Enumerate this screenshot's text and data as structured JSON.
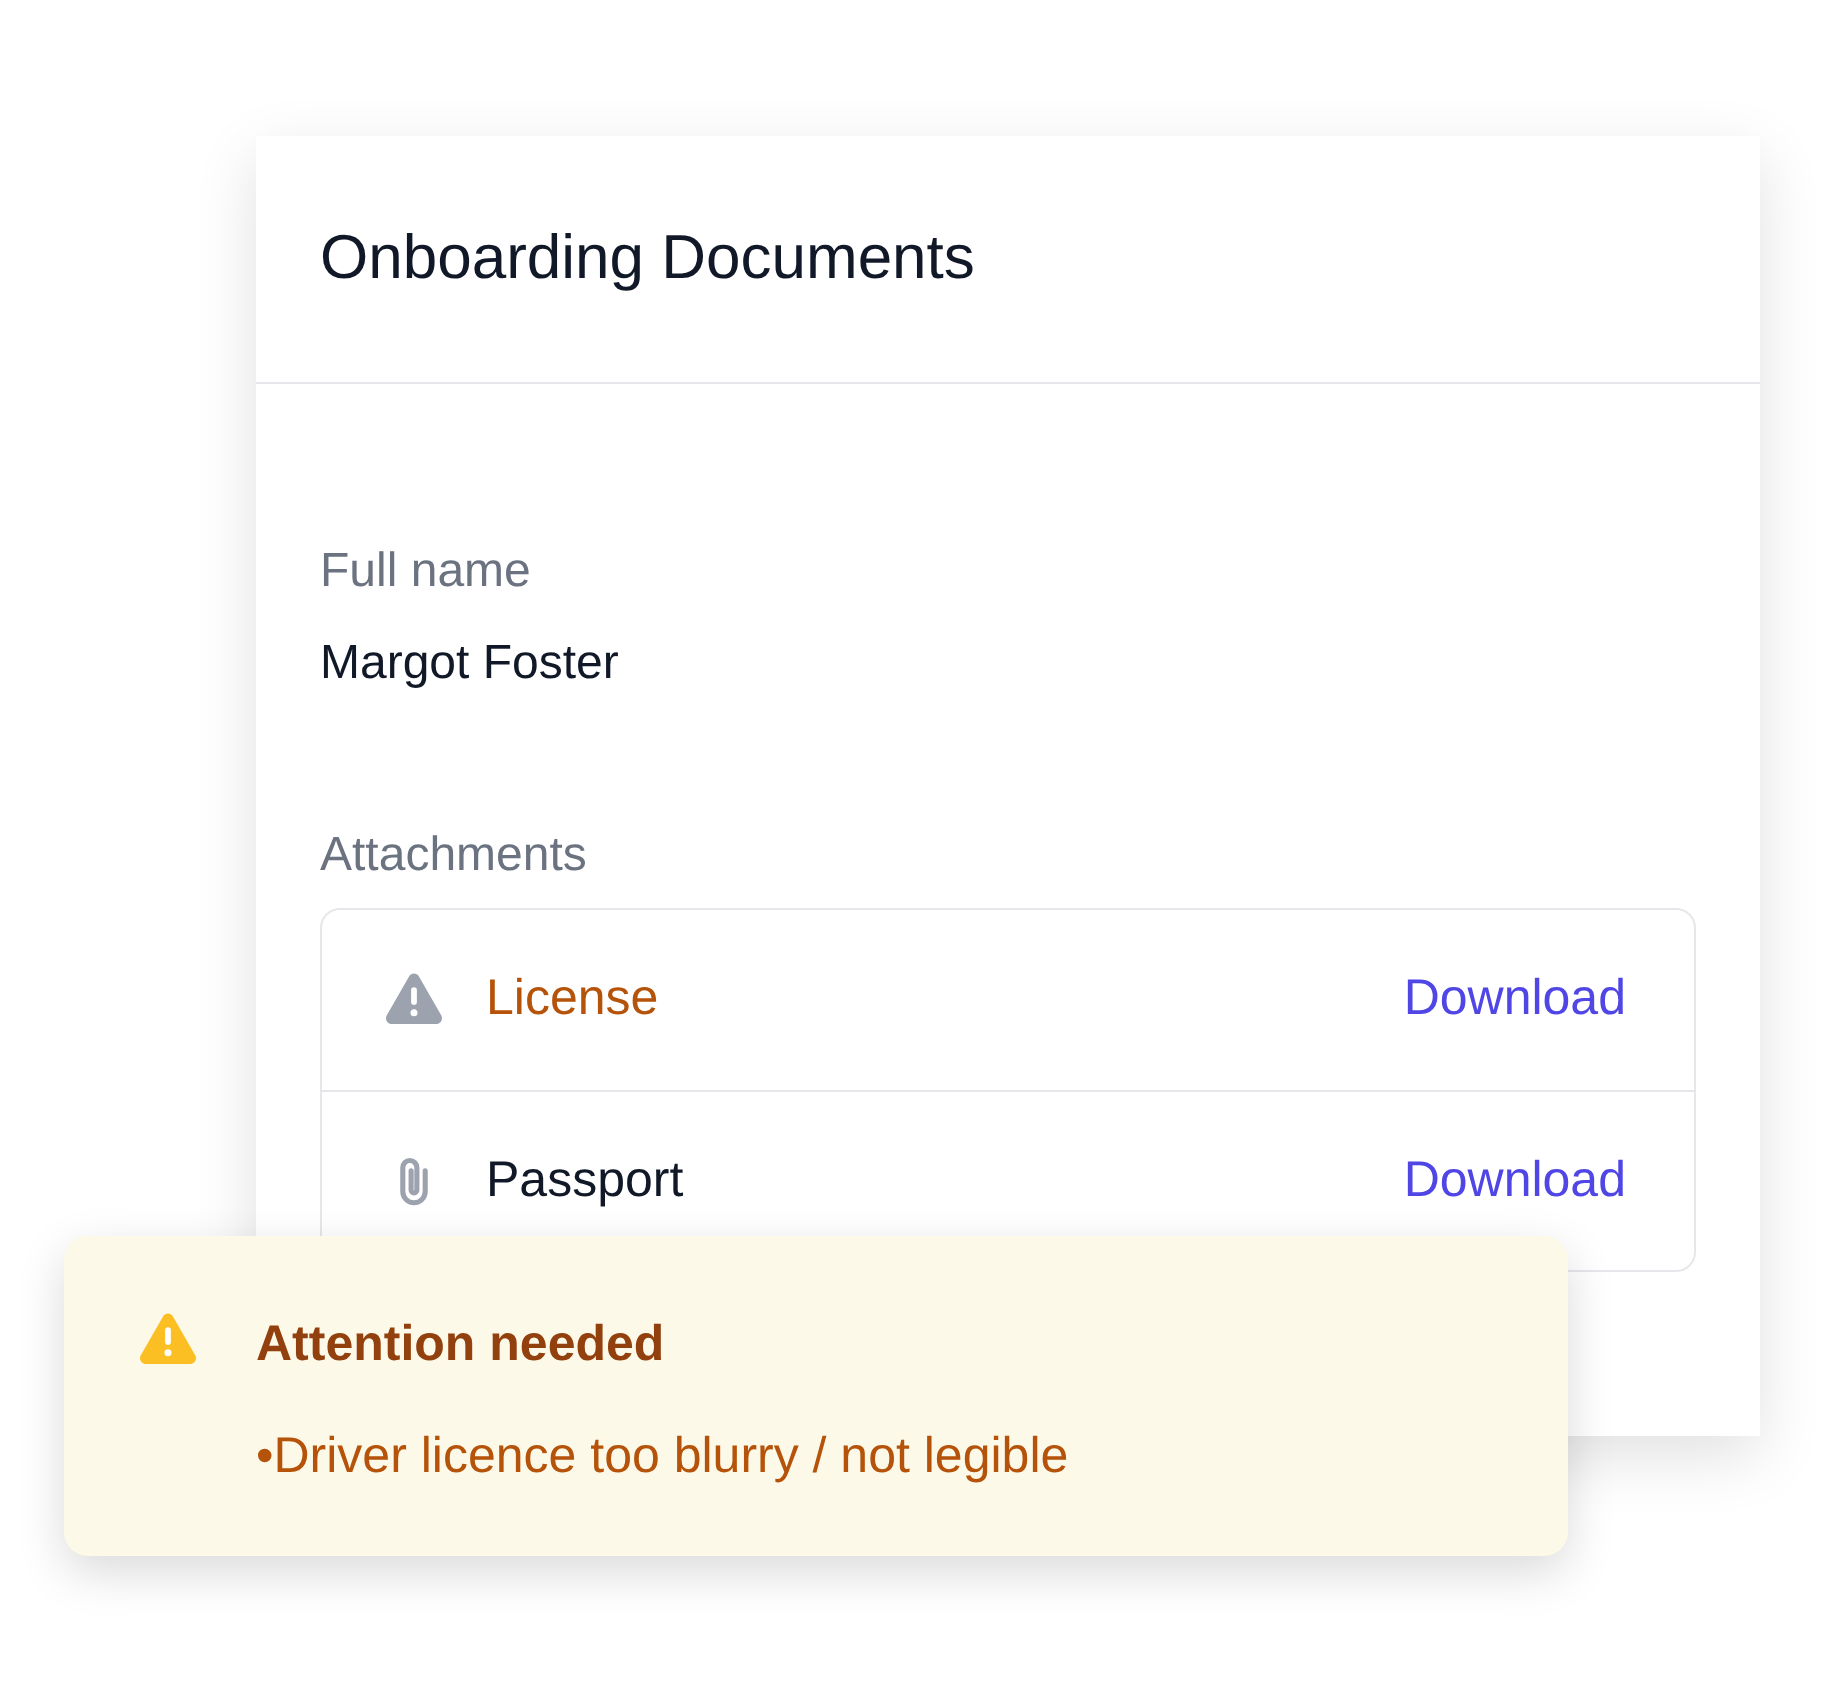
{
  "card": {
    "title": "Onboarding Documents"
  },
  "fields": [
    {
      "label": "Full name",
      "value": "Margot Foster"
    }
  ],
  "attachments": {
    "label": "Attachments",
    "items": [
      {
        "kind": "warning",
        "name": "License",
        "action": "Download"
      },
      {
        "kind": "file",
        "name": "Passport",
        "action": "Download"
      }
    ]
  },
  "alert": {
    "title": "Attention needed",
    "items": [
      "•Driver licence too blurry / not legible"
    ]
  }
}
